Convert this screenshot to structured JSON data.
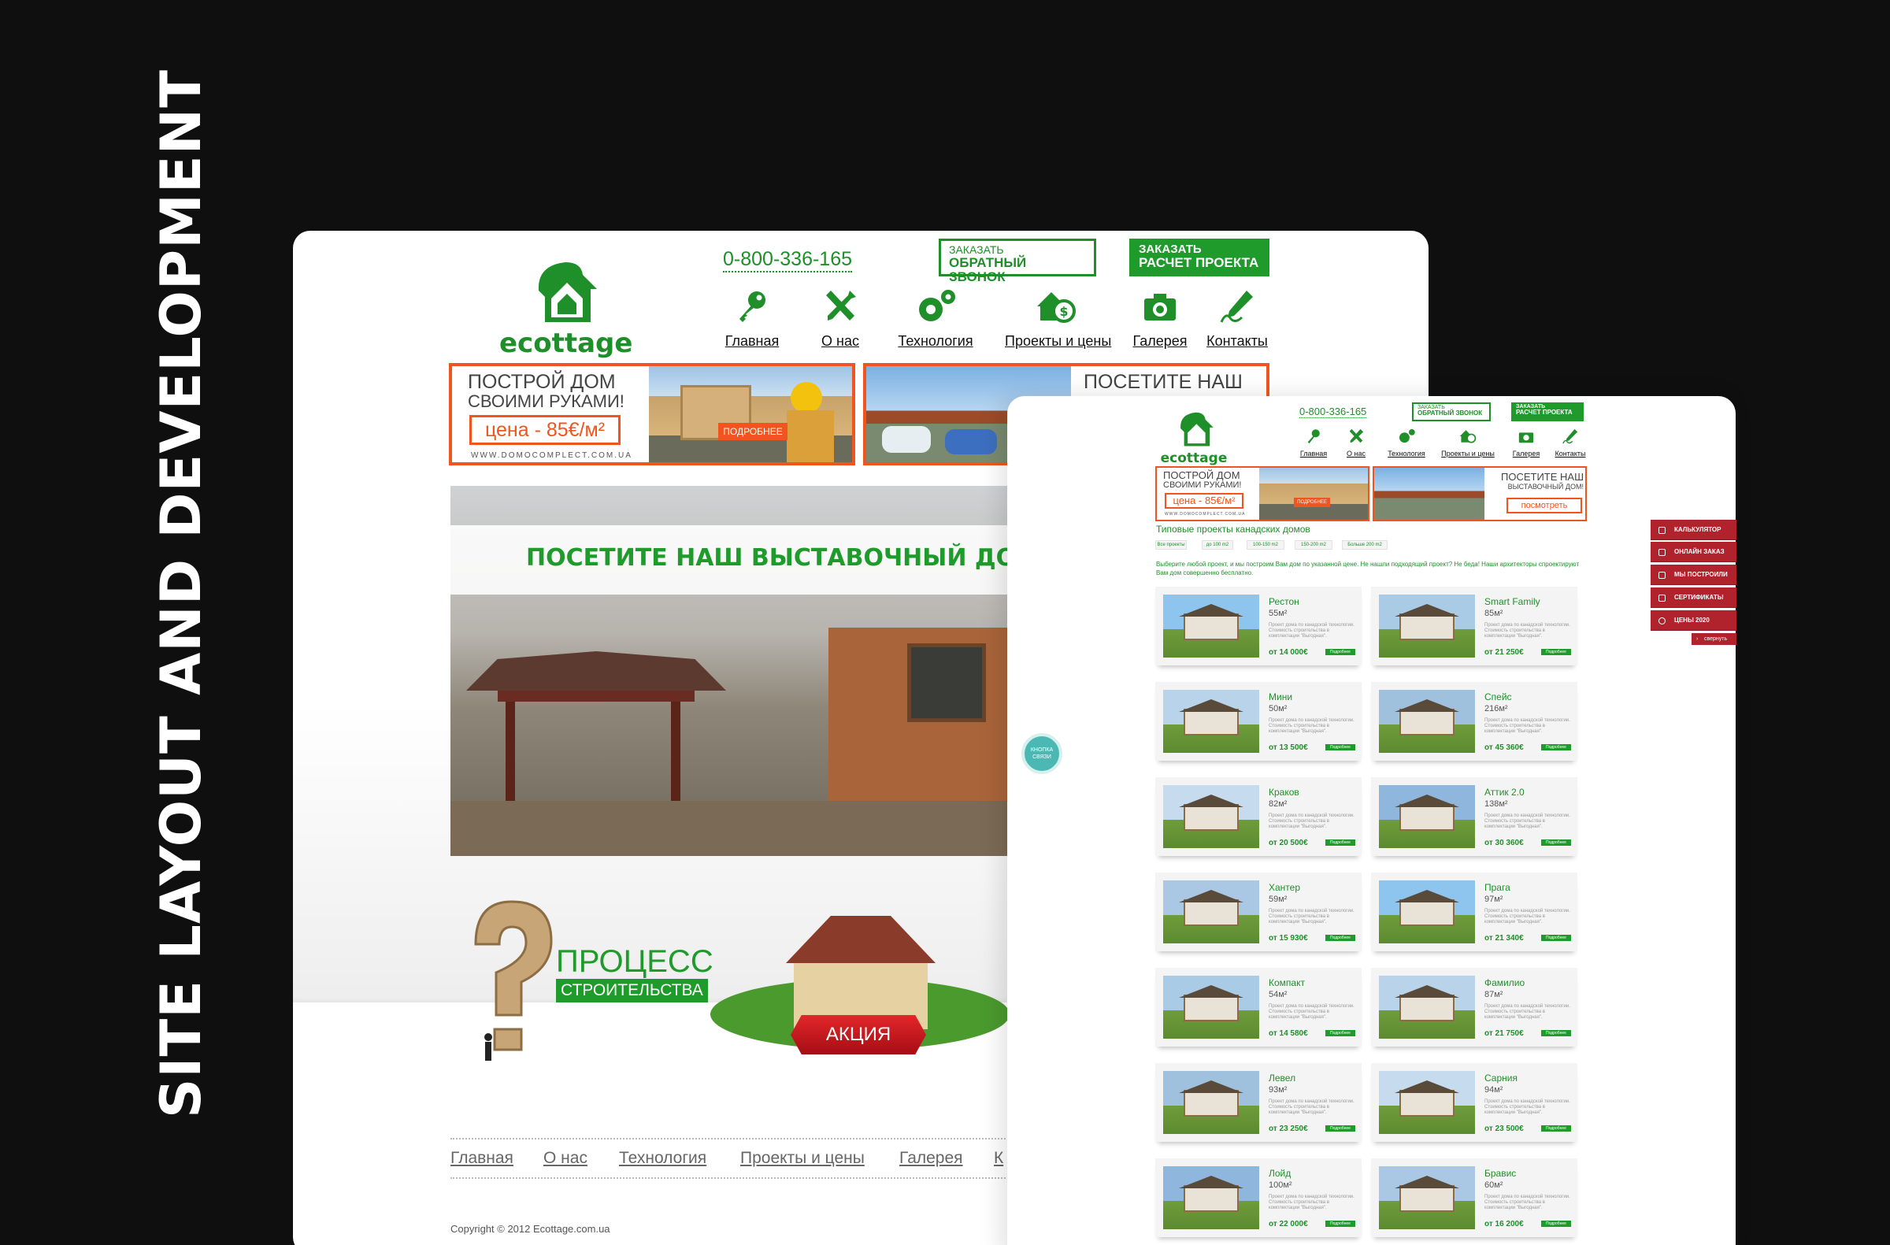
{
  "caption": "SITE LAYOUT AND DEVELOPMENT",
  "brand": {
    "name": "ecottage",
    "green": "#1f8f2a",
    "orange": "#f0551f",
    "red": "#b0222c"
  },
  "header": {
    "phone": "0-800-336-165",
    "callback": {
      "line1": "ЗАКАЗАТЬ",
      "line2": "ОБРАТНЫЙ ЗВОНОК"
    },
    "calc": {
      "line1": "ЗАКАЗАТЬ",
      "line2": "РАСЧЕТ ПРОЕКТА"
    },
    "nav": [
      {
        "label": "Главная",
        "icon": "key-icon"
      },
      {
        "label": "О нас",
        "icon": "tools-icon"
      },
      {
        "label": "Технология",
        "icon": "gears-icon"
      },
      {
        "label": "Проекты и цены",
        "icon": "house-dollar-icon"
      },
      {
        "label": "Галерея",
        "icon": "camera-icon"
      },
      {
        "label": "Контакты",
        "icon": "pen-icon"
      }
    ]
  },
  "banners": {
    "left": {
      "line1": "ПОСТРОЙ ДОМ",
      "line2": "СВОИМИ РУКАМИ!",
      "price": "цена - 85€/м²",
      "more": "ПОДРОБНЕЕ",
      "url": "WWW.DOMOCOMPLECT.COM.UA"
    },
    "right": {
      "line1": "ПОСЕТИТЕ НАШ",
      "line2": "ВЫСТАВОЧНЫЙ ДОМ!",
      "more": "посмотреть"
    }
  },
  "hero": {
    "title": "ПОСЕТИТЕ НАШ ВЫСТАВОЧНЫЙ ДОМ-С"
  },
  "promo": {
    "process1": "ПРОЦЕСС",
    "process2": "СТРОИТЕЛЬСТВА",
    "sale": "АКЦИЯ"
  },
  "footer": {
    "nav": [
      "Главная",
      "О нас",
      "Технология",
      "Проекты и цены",
      "Галерея",
      "К"
    ],
    "copyright": "Copyright © 2012 Ecottage.com.ua"
  },
  "catalog": {
    "title": "Типовые проекты канадских домов",
    "filters": [
      "Все проекты",
      "до 100 m2",
      "100-150 m2",
      "150-200 m2",
      "Больше 200 m2"
    ],
    "intro": "Выберите любой проект, и мы построим Вам дом по указанной цене. Не нашли подходящий проект? Не беда! Наши архитекторы спроектируют Вам дом совершенно бесплатно.",
    "desc": "Проект дома по канадской технологии. Стоимость строительства в комплектации \"Выгодная\".",
    "more": "Подробнее",
    "items": [
      {
        "name": "Рестон",
        "area": "55м²",
        "price": "от 14 000€"
      },
      {
        "name": "Smart Family",
        "area": "85м²",
        "price": "от 21 250€"
      },
      {
        "name": "Мини",
        "area": "50м²",
        "price": "от 13 500€"
      },
      {
        "name": "Спейс",
        "area": "216м²",
        "price": "от 45 360€"
      },
      {
        "name": "Краков",
        "area": "82м²",
        "price": "от 20 500€"
      },
      {
        "name": "Аттик 2.0",
        "area": "138м²",
        "price": "от 30 360€"
      },
      {
        "name": "Хантер",
        "area": "59м²",
        "price": "от 15 930€"
      },
      {
        "name": "Прага",
        "area": "97м²",
        "price": "от 21 340€"
      },
      {
        "name": "Компакт",
        "area": "54м²",
        "price": "от 14 580€"
      },
      {
        "name": "Фамилио",
        "area": "87м²",
        "price": "от 21 750€"
      },
      {
        "name": "Левел",
        "area": "93м²",
        "price": "от 23 250€"
      },
      {
        "name": "Сарния",
        "area": "94м²",
        "price": "от 23 500€"
      },
      {
        "name": "Лойд",
        "area": "100м²",
        "price": "от 22 000€"
      },
      {
        "name": "Бравис",
        "area": "60м²",
        "price": "от 16 200€"
      }
    ]
  },
  "sidebar": {
    "items": [
      "КАЛЬКУЛЯТОР",
      "ОНЛАЙН ЗАКАЗ",
      "МЫ ПОСТРОИЛИ",
      "СЕРТИФИКАТЫ",
      "ЦЕНЫ 2020"
    ],
    "collapse": "свернуть"
  },
  "float_button": "КНОПКА СВЯЗИ"
}
